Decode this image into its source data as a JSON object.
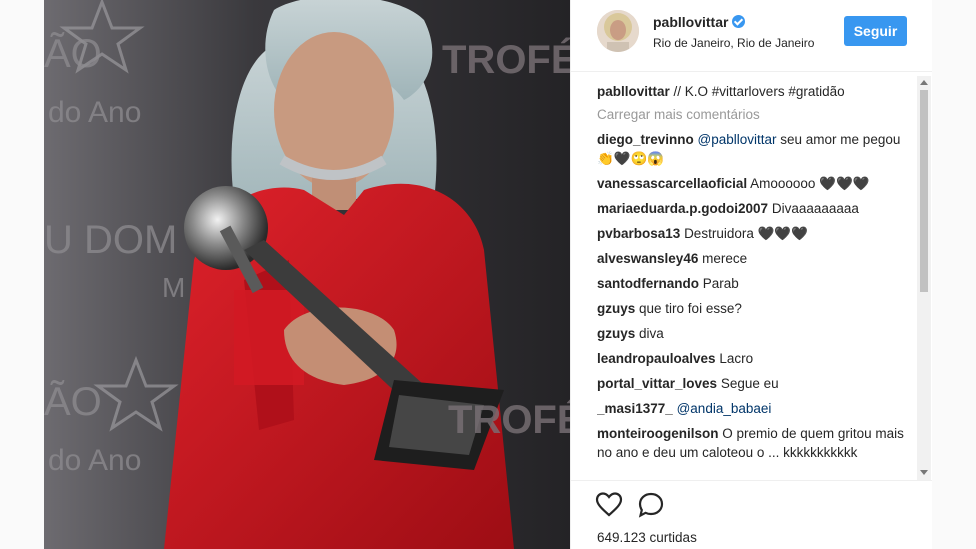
{
  "post": {
    "username": "pabllovittar",
    "location": "Rio de Janeiro, Rio de Janeiro",
    "follow_label": "Seguir",
    "caption_user": "pabllovittar",
    "caption_text": "// K.O #vittarlovers #gratidão",
    "load_more": "Carregar mais comentários",
    "likes": "649.123 curtidas"
  },
  "backdrop": {
    "left_lines": [
      "ÃO",
      "do Ano",
      "U DOM",
      "M",
      "ÃO",
      "do Ano"
    ],
    "right_lines": [
      "TROFÉ",
      "TROFÉ"
    ]
  },
  "comments": [
    {
      "user": "diego_trevinno",
      "mention": "@pabllovittar",
      "text": " seu amor me pegou 👏🖤🙄😱"
    },
    {
      "user": "vanessascarcellaoficial",
      "mention": "",
      "text": "Amoooooo 🖤🖤🖤"
    },
    {
      "user": "mariaeduarda.p.godoi2007",
      "mention": "",
      "text": "Divaaaaaaaaa"
    },
    {
      "user": "pvbarbosa13",
      "mention": "",
      "text": "Destruidora 🖤🖤🖤"
    },
    {
      "user": "alveswansley46",
      "mention": "",
      "text": "merece"
    },
    {
      "user": "santodfernando",
      "mention": "",
      "text": "Parab"
    },
    {
      "user": "gzuys",
      "mention": "",
      "text": "que tiro foi esse?"
    },
    {
      "user": "gzuys",
      "mention": "",
      "text": "diva"
    },
    {
      "user": "leandropauloalves",
      "mention": "",
      "text": "Lacro"
    },
    {
      "user": "portal_vittar_loves",
      "mention": "",
      "text": "Segue eu"
    },
    {
      "user": "_masi1377_",
      "mention": "@andia_babaei",
      "text": ""
    },
    {
      "user": "monteiroogenilson",
      "mention": "",
      "text": "O premio de quem gritou mais no ano e deu um caloteou o ... kkkkkkkkkkk"
    }
  ],
  "icons": {
    "like": "heart-icon",
    "comment": "comment-icon",
    "verified": "verified-badge-icon"
  },
  "colors": {
    "accent": "#3897f0",
    "text": "#262626",
    "muted": "#999999",
    "jacket": "#c8121b"
  }
}
